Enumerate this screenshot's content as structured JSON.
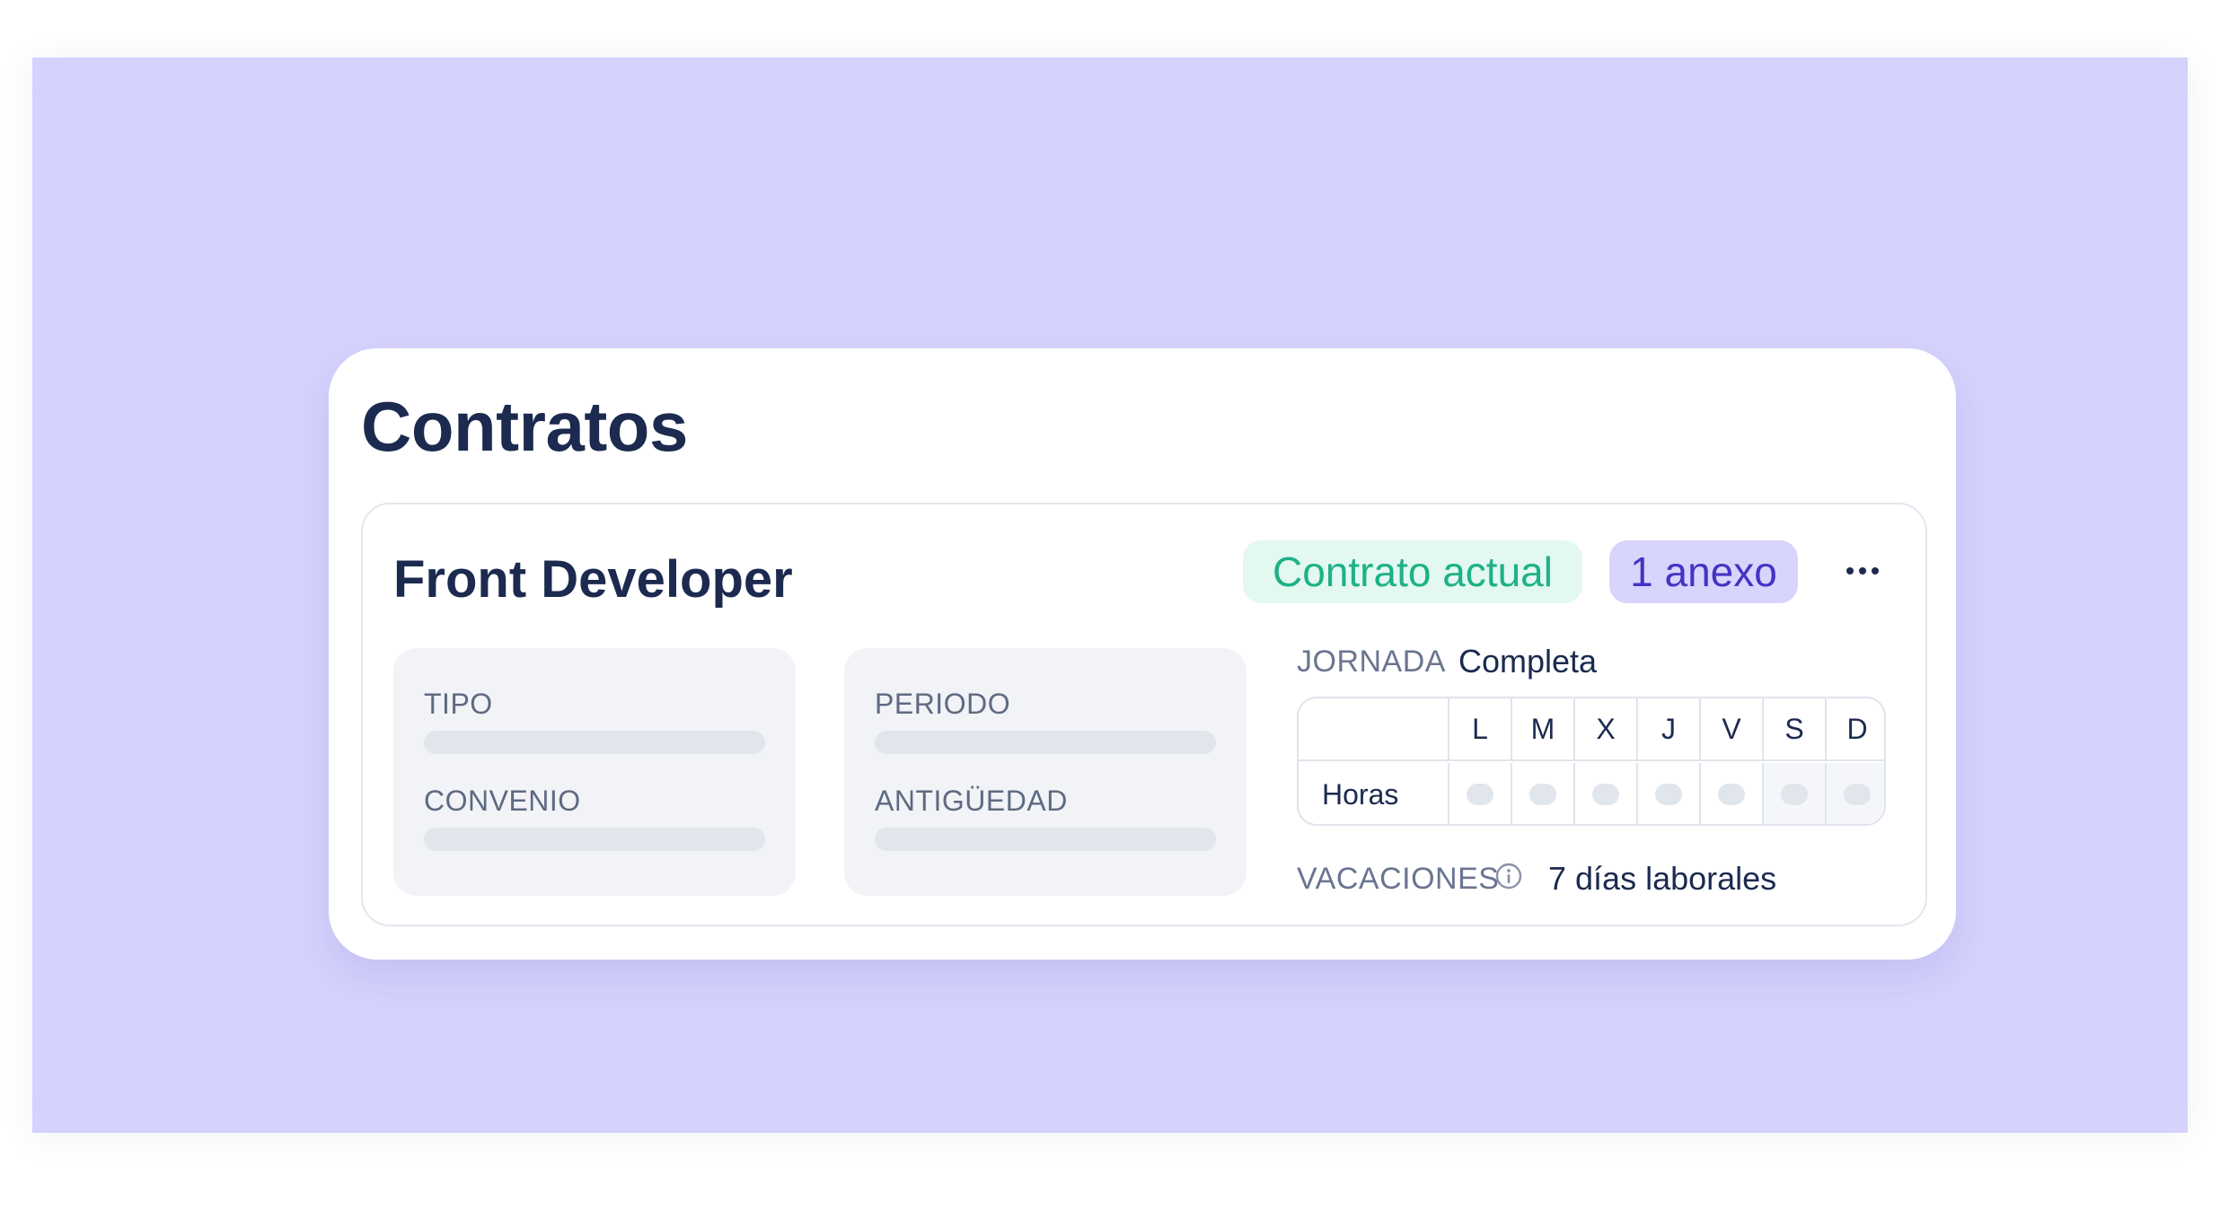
{
  "page": {
    "title": "Contratos"
  },
  "contract": {
    "role": "Front Developer",
    "badges": {
      "current": "Contrato actual",
      "annex": "1 anexo"
    },
    "fields": {
      "tipo": "TIPO",
      "convenio": "CONVENIO",
      "periodo": "PERIODO",
      "antiguedad": "ANTIGÜEDAD"
    },
    "jornada": {
      "label": "JORNADA",
      "value": "Completa"
    },
    "schedule": {
      "row_label": "Horas",
      "days": [
        "L",
        "M",
        "X",
        "J",
        "V",
        "S",
        "D"
      ]
    },
    "vacaciones": {
      "label": "VACACIONES",
      "value": "7 días laborales"
    }
  },
  "colors": {
    "background": "#d5d2fd",
    "badge_current_text": "#1eb187",
    "badge_annex_text": "#4433c4",
    "title_text": "#1c2a4f"
  },
  "icons": [
    "more-options-icon",
    "info-icon"
  ]
}
